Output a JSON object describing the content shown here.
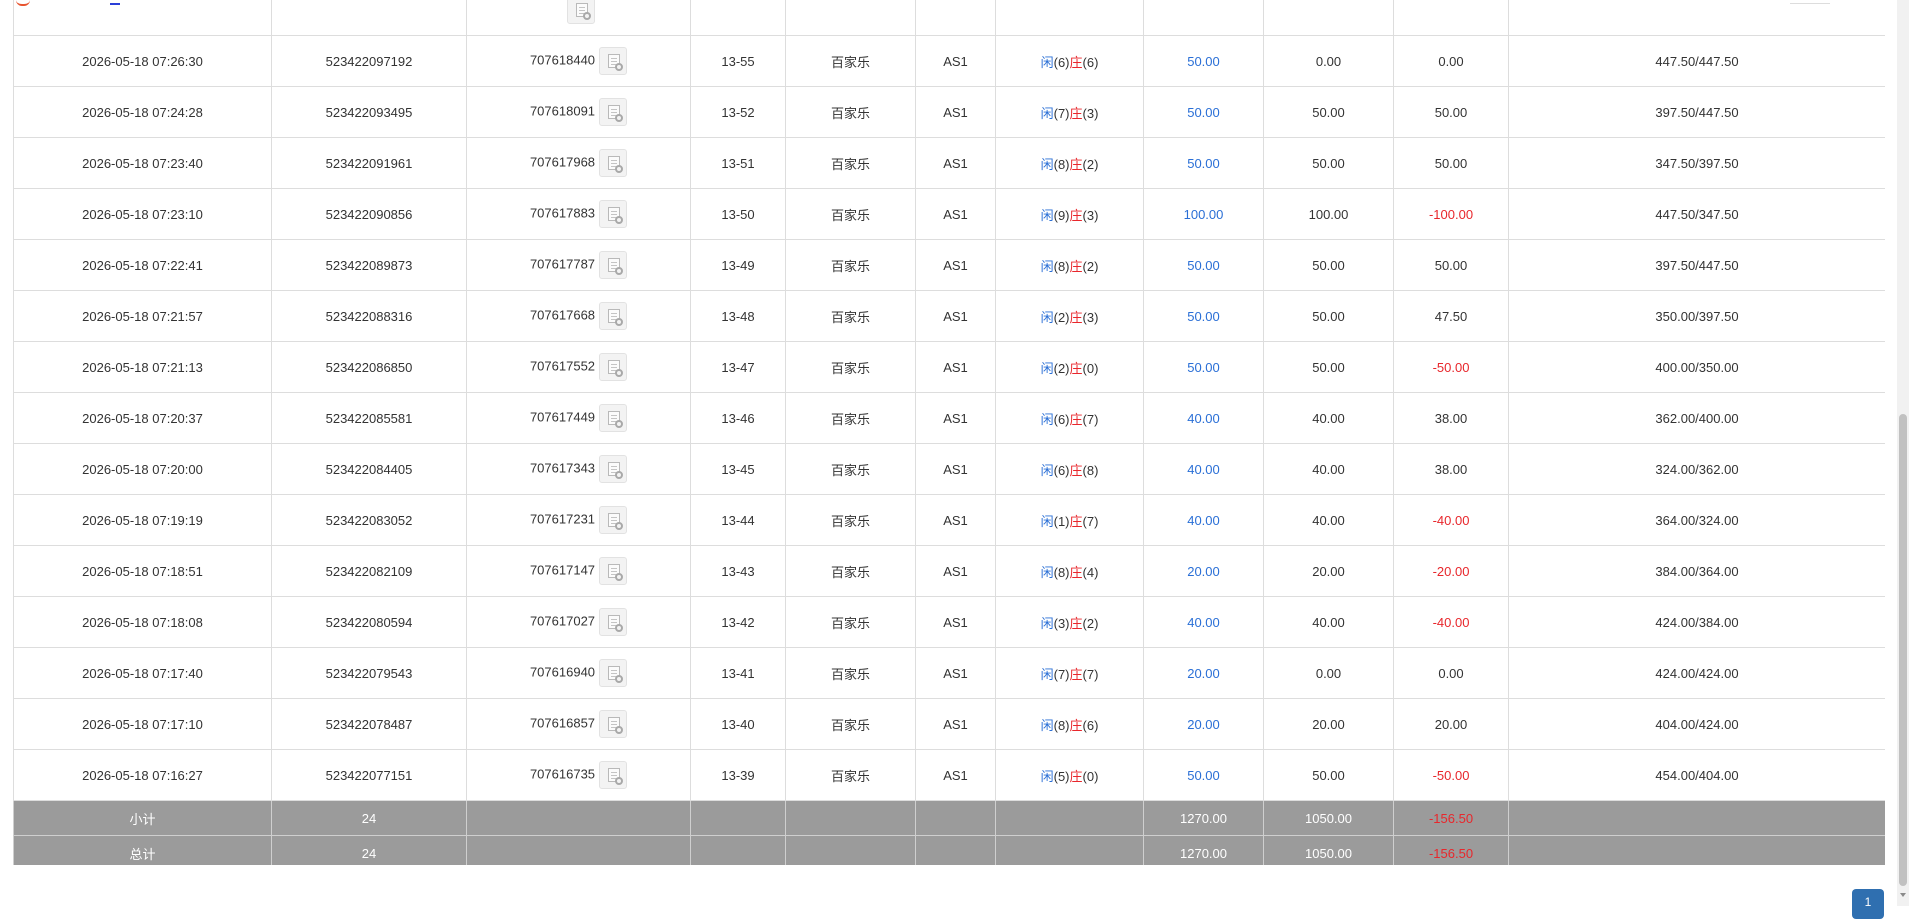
{
  "rows": [
    {
      "time": "2026-05-18 07:26:30",
      "bet_id": "523422097192",
      "round_id": "707618440",
      "shoe": "13-55",
      "game": "百家乐",
      "table": "AS1",
      "result": {
        "xian_label": "闲",
        "xian": "(6)",
        "zhuang_label": "庄",
        "zhuang": "(6)"
      },
      "bet": "50.00",
      "valid": "0.00",
      "win_loss": "0.00",
      "balance": "447.50/447.50",
      "win_loss_color": "normal"
    },
    {
      "time": "2026-05-18 07:24:28",
      "bet_id": "523422093495",
      "round_id": "707618091",
      "shoe": "13-52",
      "game": "百家乐",
      "table": "AS1",
      "result": {
        "xian_label": "闲",
        "xian": "(7)",
        "zhuang_label": "庄",
        "zhuang": "(3)"
      },
      "bet": "50.00",
      "valid": "50.00",
      "win_loss": "50.00",
      "balance": "397.50/447.50",
      "win_loss_color": "normal"
    },
    {
      "time": "2026-05-18 07:23:40",
      "bet_id": "523422091961",
      "round_id": "707617968",
      "shoe": "13-51",
      "game": "百家乐",
      "table": "AS1",
      "result": {
        "xian_label": "闲",
        "xian": "(8)",
        "zhuang_label": "庄",
        "zhuang": "(2)"
      },
      "bet": "50.00",
      "valid": "50.00",
      "win_loss": "50.00",
      "balance": "347.50/397.50",
      "win_loss_color": "normal"
    },
    {
      "time": "2026-05-18 07:23:10",
      "bet_id": "523422090856",
      "round_id": "707617883",
      "shoe": "13-50",
      "game": "百家乐",
      "table": "AS1",
      "result": {
        "xian_label": "闲",
        "xian": "(9)",
        "zhuang_label": "庄",
        "zhuang": "(3)"
      },
      "bet": "100.00",
      "valid": "100.00",
      "win_loss": "-100.00",
      "balance": "447.50/347.50",
      "win_loss_color": "red"
    },
    {
      "time": "2026-05-18 07:22:41",
      "bet_id": "523422089873",
      "round_id": "707617787",
      "shoe": "13-49",
      "game": "百家乐",
      "table": "AS1",
      "result": {
        "xian_label": "闲",
        "xian": "(8)",
        "zhuang_label": "庄",
        "zhuang": "(2)"
      },
      "bet": "50.00",
      "valid": "50.00",
      "win_loss": "50.00",
      "balance": "397.50/447.50",
      "win_loss_color": "normal"
    },
    {
      "time": "2026-05-18 07:21:57",
      "bet_id": "523422088316",
      "round_id": "707617668",
      "shoe": "13-48",
      "game": "百家乐",
      "table": "AS1",
      "result": {
        "xian_label": "闲",
        "xian": "(2)",
        "zhuang_label": "庄",
        "zhuang": "(3)"
      },
      "bet": "50.00",
      "valid": "50.00",
      "win_loss": "47.50",
      "balance": "350.00/397.50",
      "win_loss_color": "normal"
    },
    {
      "time": "2026-05-18 07:21:13",
      "bet_id": "523422086850",
      "round_id": "707617552",
      "shoe": "13-47",
      "game": "百家乐",
      "table": "AS1",
      "result": {
        "xian_label": "闲",
        "xian": "(2)",
        "zhuang_label": "庄",
        "zhuang": "(0)"
      },
      "bet": "50.00",
      "valid": "50.00",
      "win_loss": "-50.00",
      "balance": "400.00/350.00",
      "win_loss_color": "red"
    },
    {
      "time": "2026-05-18 07:20:37",
      "bet_id": "523422085581",
      "round_id": "707617449",
      "shoe": "13-46",
      "game": "百家乐",
      "table": "AS1",
      "result": {
        "xian_label": "闲",
        "xian": "(6)",
        "zhuang_label": "庄",
        "zhuang": "(7)"
      },
      "bet": "40.00",
      "valid": "40.00",
      "win_loss": "38.00",
      "balance": "362.00/400.00",
      "win_loss_color": "normal"
    },
    {
      "time": "2026-05-18 07:20:00",
      "bet_id": "523422084405",
      "round_id": "707617343",
      "shoe": "13-45",
      "game": "百家乐",
      "table": "AS1",
      "result": {
        "xian_label": "闲",
        "xian": "(6)",
        "zhuang_label": "庄",
        "zhuang": "(8)"
      },
      "bet": "40.00",
      "valid": "40.00",
      "win_loss": "38.00",
      "balance": "324.00/362.00",
      "win_loss_color": "normal"
    },
    {
      "time": "2026-05-18 07:19:19",
      "bet_id": "523422083052",
      "round_id": "707617231",
      "shoe": "13-44",
      "game": "百家乐",
      "table": "AS1",
      "result": {
        "xian_label": "闲",
        "xian": "(1)",
        "zhuang_label": "庄",
        "zhuang": "(7)"
      },
      "bet": "40.00",
      "valid": "40.00",
      "win_loss": "-40.00",
      "balance": "364.00/324.00",
      "win_loss_color": "red"
    },
    {
      "time": "2026-05-18 07:18:51",
      "bet_id": "523422082109",
      "round_id": "707617147",
      "shoe": "13-43",
      "game": "百家乐",
      "table": "AS1",
      "result": {
        "xian_label": "闲",
        "xian": "(8)",
        "zhuang_label": "庄",
        "zhuang": "(4)"
      },
      "bet": "20.00",
      "valid": "20.00",
      "win_loss": "-20.00",
      "balance": "384.00/364.00",
      "win_loss_color": "red"
    },
    {
      "time": "2026-05-18 07:18:08",
      "bet_id": "523422080594",
      "round_id": "707617027",
      "shoe": "13-42",
      "game": "百家乐",
      "table": "AS1",
      "result": {
        "xian_label": "闲",
        "xian": "(3)",
        "zhuang_label": "庄",
        "zhuang": "(2)"
      },
      "bet": "40.00",
      "valid": "40.00",
      "win_loss": "-40.00",
      "balance": "424.00/384.00",
      "win_loss_color": "red"
    },
    {
      "time": "2026-05-18 07:17:40",
      "bet_id": "523422079543",
      "round_id": "707616940",
      "shoe": "13-41",
      "game": "百家乐",
      "table": "AS1",
      "result": {
        "xian_label": "闲",
        "xian": "(7)",
        "zhuang_label": "庄",
        "zhuang": "(7)"
      },
      "bet": "20.00",
      "valid": "0.00",
      "win_loss": "0.00",
      "balance": "424.00/424.00",
      "win_loss_color": "normal"
    },
    {
      "time": "2026-05-18 07:17:10",
      "bet_id": "523422078487",
      "round_id": "707616857",
      "shoe": "13-40",
      "game": "百家乐",
      "table": "AS1",
      "result": {
        "xian_label": "闲",
        "xian": "(8)",
        "zhuang_label": "庄",
        "zhuang": "(6)"
      },
      "bet": "20.00",
      "valid": "20.00",
      "win_loss": "20.00",
      "balance": "404.00/424.00",
      "win_loss_color": "normal"
    },
    {
      "time": "2026-05-18 07:16:27",
      "bet_id": "523422077151",
      "round_id": "707616735",
      "shoe": "13-39",
      "game": "百家乐",
      "table": "AS1",
      "result": {
        "xian_label": "闲",
        "xian": "(5)",
        "zhuang_label": "庄",
        "zhuang": "(0)"
      },
      "bet": "50.00",
      "valid": "50.00",
      "win_loss": "-50.00",
      "balance": "454.00/404.00",
      "win_loss_color": "red"
    }
  ],
  "summary": {
    "subtotal": {
      "label": "小计",
      "count": "24",
      "bet": "1270.00",
      "valid": "1050.00",
      "win_loss": "-156.50"
    },
    "total": {
      "label": "总计",
      "count": "24",
      "bet": "1270.00",
      "valid": "1050.00",
      "win_loss": "-156.50"
    }
  },
  "pagination": {
    "current_page": "1"
  },
  "colors": {
    "blue": "#2a6fd6",
    "red": "#e8272c",
    "summary_bg": "#9b9b9b",
    "pager": "#2f6fb0"
  },
  "icons": {
    "detail": "replay-detail-icon"
  }
}
